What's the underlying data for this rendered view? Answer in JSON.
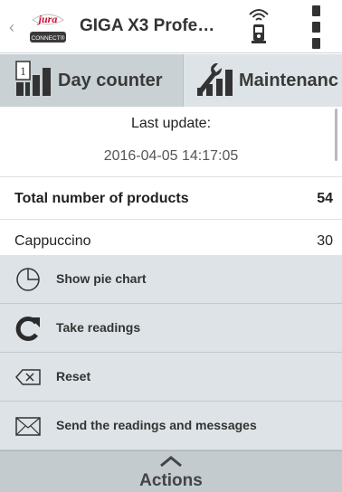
{
  "header": {
    "title": "GIGA X3 Profe…",
    "logo_text": "jura",
    "logo_subtext": "CONNECT®",
    "back_icon": "chevron-left-icon",
    "connection_icon": "wifi-device-icon",
    "menu_icon": "more-vertical-icon"
  },
  "tabs": [
    {
      "label": "Day counter",
      "icon": "counter-icon",
      "selected": true
    },
    {
      "label": "Maintenanc",
      "icon": "wrench-chart-icon",
      "selected": false
    }
  ],
  "info": {
    "last_update_label": "Last update:",
    "last_update_value": "2016-04-05 14:17:05"
  },
  "counters": [
    {
      "name": "Total number of products",
      "value": "54"
    },
    {
      "name": "Cappuccino",
      "value": "30"
    }
  ],
  "action_list": [
    {
      "label": "Show pie chart",
      "icon": "pie-chart-icon"
    },
    {
      "label": "Take readings",
      "icon": "refresh-icon"
    },
    {
      "label": "Reset",
      "icon": "backspace-icon"
    },
    {
      "label": "Send the readings and messages",
      "icon": "envelope-icon"
    }
  ],
  "footer": {
    "label": "Actions",
    "icon": "chevron-up-icon"
  },
  "colors": {
    "tab_bar": "#dde3e6",
    "tab_selected": "#c9d1d5",
    "action_bg": "#dde3e6",
    "footer_bg": "#c3cbcf",
    "logo_red": "#c8102e"
  }
}
